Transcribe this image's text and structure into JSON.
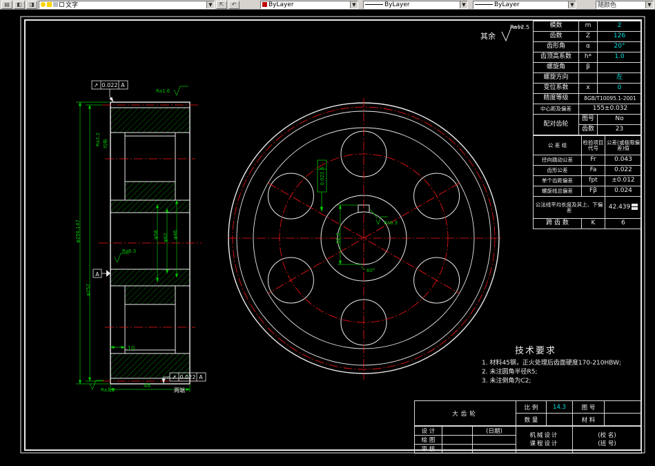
{
  "toolbar": {
    "layer_value": "文字",
    "color_value": "ByLayer",
    "linetype_value": "ByLayer",
    "lineweight_value": "ByLayer",
    "plot_style_value": "随颜色"
  },
  "annotations": {
    "surface_other": "其余",
    "surface_other_ra": "Ra12.5",
    "ra16": "Ra1.6",
    "ra32_top": "Ra3.2",
    "ra32_bottom": "Ra3.2",
    "ra63_hub": "Ra6.3",
    "ra63_key": "Ra6.3",
    "evenly": "均布",
    "dim_tip": "φ256.147",
    "dim_pitch": "φ252",
    "dim_bore": "φ58",
    "dim_hub": "φ62",
    "dim_inner": "φ46",
    "dim_recess": "10",
    "dim_width": "48",
    "dim_keyway": "62.3",
    "dim_angle": "60°",
    "both_ends": "两端",
    "datum": "A",
    "tol_top": {
      "sym": "↗",
      "value": "0.022",
      "datum": "A"
    },
    "tol_bottom": {
      "sym": "↗",
      "value": "0.022",
      "datum": "A"
    },
    "tol_side": "0.022 A"
  },
  "gear_table": {
    "rows": [
      {
        "label": "模数",
        "sym": "m",
        "val": "2"
      },
      {
        "label": "齿数",
        "sym": "Z",
        "val": "126"
      },
      {
        "label": "齿形角",
        "sym": "α",
        "val": "20°"
      },
      {
        "label": "齿顶高系数",
        "sym": "h*",
        "val": "1.0"
      },
      {
        "label": "螺旋角",
        "sym": "β",
        "val": ""
      },
      {
        "label": "螺旋方向",
        "sym": "",
        "val": "左"
      },
      {
        "label": "变位系数",
        "sym": "x",
        "val": "0"
      }
    ],
    "precision_label": "精度等级",
    "precision_value": "8GB/T10095.1-2001",
    "center_label": "中心距及偏差",
    "center_value": "155±0.032",
    "mate_label": "配对齿轮",
    "mate_rows": [
      {
        "label": "图号",
        "val": "No"
      },
      {
        "label": "齿数",
        "val": "23"
      }
    ],
    "tol_header": {
      "group": "公 差 组",
      "item": "检验项目代号",
      "tol": "公差(或极限偏差)值"
    },
    "tol_rows": [
      {
        "label": "径向跳动公差",
        "sym": "Fr",
        "val": "0.043"
      },
      {
        "label": "齿形公差",
        "sym": "Fa",
        "val": "0.022"
      },
      {
        "label": "单个齿距偏差",
        "sym": "fpt",
        "val": "±0.012"
      },
      {
        "label": "螺旋线总偏差",
        "sym": "Fβ",
        "val": "0.024"
      }
    ],
    "base_tangent_label": "公法线平均长度及其上、下偏差",
    "base_tangent_value": "42.439",
    "span_label": "跨 齿 数",
    "span_sym": "K",
    "span_val": "6"
  },
  "tech_req": {
    "title": "技术要求",
    "item1": "1. 材料45钢，正火处理后齿面硬度170-210HBW;",
    "item2": "2. 未注圆角半径R5;",
    "item3": "3. 未注倒角为C2;"
  },
  "title_block": {
    "part_name": "大齿轮",
    "scale_label": "比 例",
    "scale_value": "14.3",
    "drawno_label": "图 号",
    "qty_label": "数 量",
    "material_label": "材 料",
    "design_label": "设 计",
    "date_label": "(日期)",
    "draw_label": "绘 图",
    "check_label": "审 核",
    "course_line1": "机械设计",
    "course_line2": "课程设计",
    "school_name": "(校 名)",
    "class_no": "(班 号)"
  }
}
